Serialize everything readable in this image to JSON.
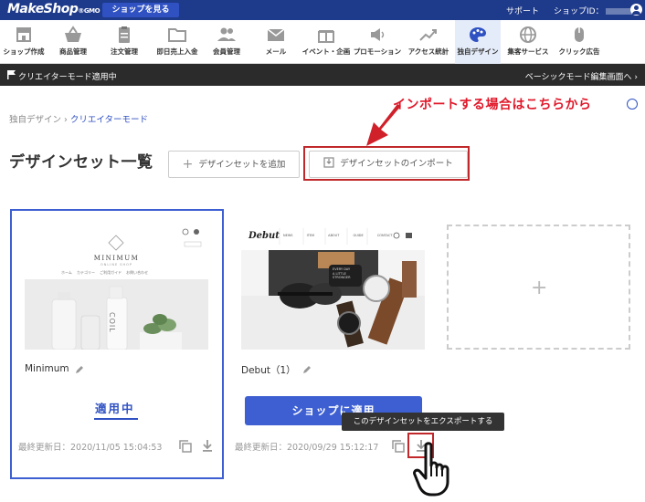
{
  "header": {
    "logo": "MakeShop",
    "logo_suffix": "®GMO",
    "shop_button": "ショップを見る",
    "support": "サポート",
    "shop_id_label": "ショップID："
  },
  "nav": {
    "items": [
      {
        "label": "ショップ作成",
        "icon": "store-icon"
      },
      {
        "label": "商品管理",
        "icon": "basket-icon"
      },
      {
        "label": "注文管理",
        "icon": "clipboard-icon"
      },
      {
        "label": "即日売上入金",
        "icon": "folder-icon"
      },
      {
        "label": "会員管理",
        "icon": "users-icon"
      },
      {
        "label": "メール",
        "icon": "mail-icon"
      },
      {
        "label": "イベント・企画",
        "icon": "gift-icon"
      },
      {
        "label": "プロモーション",
        "icon": "speaker-icon"
      },
      {
        "label": "アクセス統計",
        "icon": "trend-icon"
      },
      {
        "label": "独自デザイン",
        "icon": "palette-icon",
        "active": true
      },
      {
        "label": "集客サービス",
        "icon": "globe-icon"
      },
      {
        "label": "クリック広告",
        "icon": "mouse-icon"
      }
    ]
  },
  "mode_bar": {
    "label": "クリエイターモード適用中",
    "switch_link": "ベーシックモード編集画面へ ›"
  },
  "breadcrumb": {
    "root": "独自デザイン",
    "separator": "›",
    "current": "クリエイターモード"
  },
  "page": {
    "title": "デザインセット一覧",
    "add_button": "デザインセットを追加",
    "import_button": "デザインセットのインポート"
  },
  "annotation": {
    "callout": "インポートする場合はこちらから"
  },
  "cards": [
    {
      "name": "Minimum",
      "status": "適用中",
      "updated": "最終更新日：2020/11/05 15:04:53",
      "thumb_brand": "MINIMUM",
      "thumb_sub": "ONLINE SHOP",
      "thumb_nav": [
        "ホーム",
        "カテゴリー",
        "ご利用ガイド",
        "お問い合わせ"
      ],
      "bottle_text": "COIL"
    },
    {
      "name": "Debut（1）",
      "apply_button": "ショップに適用",
      "updated": "最終更新日：2020/09/29 15:12:17",
      "thumb_brand": "Debut",
      "thumb_nav": [
        "NEWS",
        "ITEM",
        "ABOUT",
        "GUIDE",
        "CONTACT"
      ],
      "watch_text": "EVERY DAY\nA LITTLE\nSTRONGER"
    }
  ],
  "tooltip": {
    "export": "このデザインセットをエクスポートする"
  },
  "colors": {
    "header_bg": "#1e3a8a",
    "accent": "#3d5fd1",
    "annotation_red": "#e0182a"
  }
}
